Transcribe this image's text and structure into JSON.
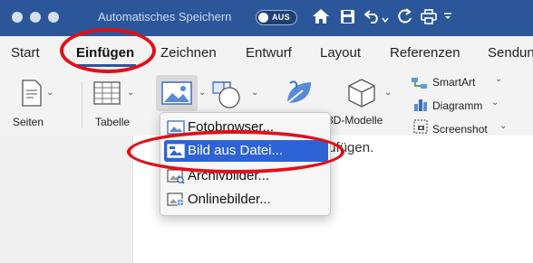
{
  "titlebar": {
    "autosave_label": "Automatisches Speichern",
    "toggle_state": "AUS",
    "icons": [
      "home-icon",
      "save-icon",
      "undo-icon",
      "redo-icon",
      "print-icon",
      "more-icon"
    ]
  },
  "tabs": [
    {
      "label": "Start"
    },
    {
      "label": "Einfügen",
      "active": true
    },
    {
      "label": "Zeichnen"
    },
    {
      "label": "Entwurf"
    },
    {
      "label": "Layout"
    },
    {
      "label": "Referenzen"
    },
    {
      "label": "Sendun"
    }
  ],
  "ribbon": {
    "pages_label": "Seiten",
    "table_label": "Tabelle",
    "models3d_label": "3D-Modelle",
    "smartart_label": "SmartArt",
    "chart_label": "Diagramm",
    "screenshot_label": "Screenshot"
  },
  "menu": {
    "items": [
      {
        "label": "Fotobrowser...",
        "icon": "photo-browser-icon"
      },
      {
        "label": "Bild aus Datei...",
        "icon": "picture-from-file-icon",
        "highlighted": true
      },
      {
        "label": "Archivbilder...",
        "icon": "stock-images-icon"
      },
      {
        "label": "Onlinebilder...",
        "icon": "online-pictures-icon"
      }
    ]
  },
  "document": {
    "visible_text": "e, einzufügen."
  },
  "colors": {
    "titlebar": "#2b579a",
    "menu_highlight": "#2e63d6",
    "annotation": "#e0101a"
  }
}
